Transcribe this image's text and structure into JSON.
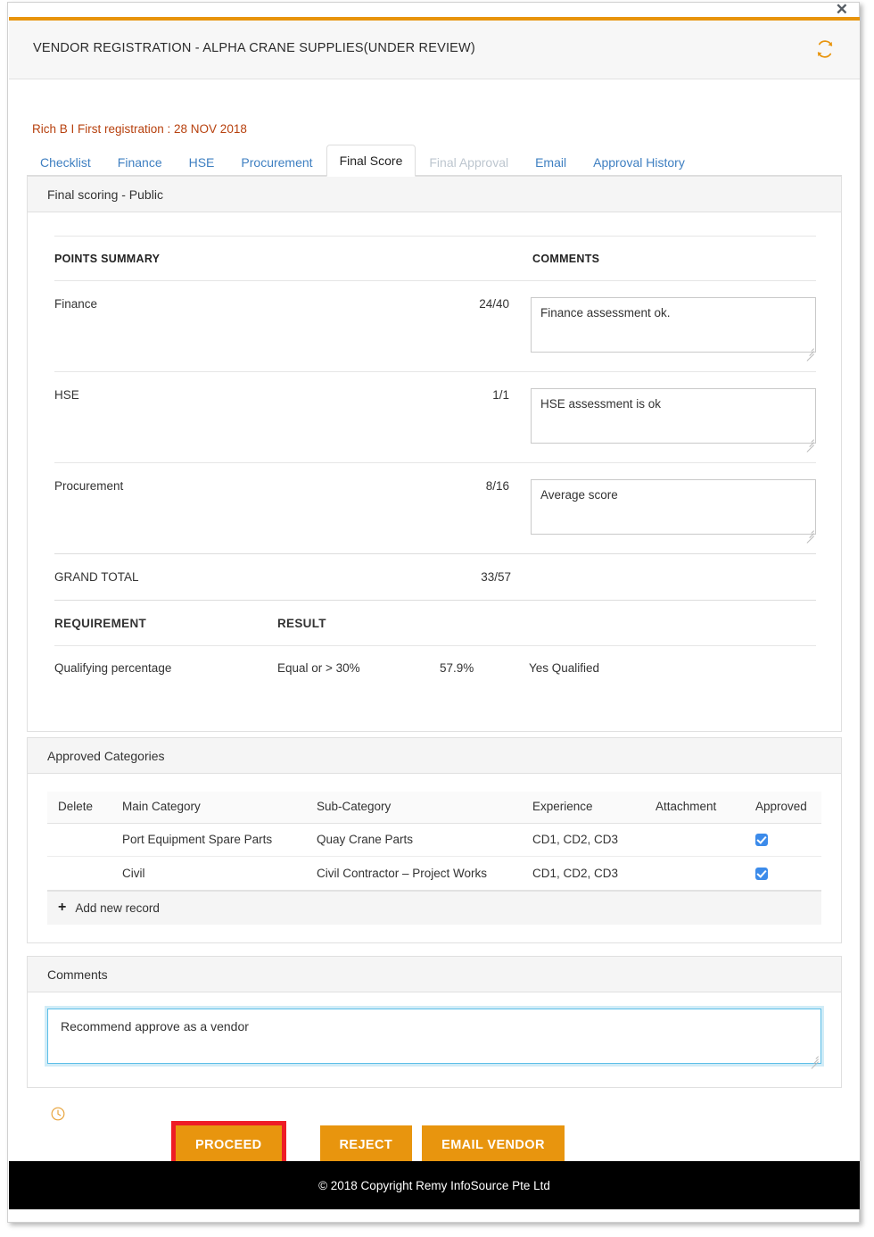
{
  "window": {
    "close_label": "✕",
    "title": "VENDOR REGISTRATION - ALPHA CRANE SUPPLIES(UNDER REVIEW)",
    "refresh_icon": "refresh-icon",
    "accent_color": "#e8940c"
  },
  "registration_line": "Rich B I First registration : 28 NOV 2018",
  "tabs": [
    {
      "label": "Checklist",
      "state": "normal"
    },
    {
      "label": "Finance",
      "state": "normal"
    },
    {
      "label": "HSE",
      "state": "normal"
    },
    {
      "label": "Procurement",
      "state": "normal"
    },
    {
      "label": "Final Score",
      "state": "active"
    },
    {
      "label": "Final Approval",
      "state": "disabled"
    },
    {
      "label": "Email",
      "state": "normal"
    },
    {
      "label": "Approval History",
      "state": "normal"
    }
  ],
  "scoring": {
    "panel_title": "Final scoring  - Public",
    "headers": {
      "points_summary": "POINTS SUMMARY",
      "comments": "COMMENTS"
    },
    "rows": [
      {
        "label": "Finance",
        "score": "24/40",
        "comment": "Finance assessment ok."
      },
      {
        "label": "HSE",
        "score": "1/1",
        "comment": "HSE assessment is ok"
      },
      {
        "label": "Procurement",
        "score": "8/16",
        "comment": "Average score"
      }
    ],
    "grand_total": {
      "label": "GRAND TOTAL",
      "score": "33/57"
    },
    "requirement_headers": {
      "requirement": "REQUIREMENT",
      "result": "RESULT"
    },
    "requirement_row": {
      "name": "Qualifying percentage",
      "criteria": "Equal or > 30%",
      "value": "57.9%",
      "status": "Yes Qualified"
    }
  },
  "categories": {
    "panel_title": "Approved Categories",
    "columns": [
      "Delete",
      "Main Category",
      "Sub-Category",
      "Experience",
      "Attachment",
      "Approved"
    ],
    "rows": [
      {
        "delete": "",
        "main_category": "Port Equipment Spare Parts",
        "sub_category": "Quay Crane Parts",
        "experience": "CD1, CD2, CD3",
        "attachment": "",
        "approved": true
      },
      {
        "delete": "",
        "main_category": "Civil",
        "sub_category": "Civil Contractor – Project Works",
        "experience": "CD1, CD2, CD3",
        "attachment": "",
        "approved": true
      }
    ],
    "add_record_label": "Add new record",
    "add_record_icon": "plus-icon"
  },
  "comments_panel": {
    "panel_title": "Comments",
    "value": "Recommend approve as a vendor",
    "placeholder": ""
  },
  "actions": {
    "history_icon": "clock-icon",
    "proceed_label": "PROCEED",
    "reject_label": "REJECT",
    "email_vendor_label": "EMAIL VENDOR",
    "highlight_color": "#ee1c25",
    "button_color": "#e8950e"
  },
  "footer": {
    "text": "© 2018 Copyright  Remy InfoSource Pte Ltd"
  }
}
